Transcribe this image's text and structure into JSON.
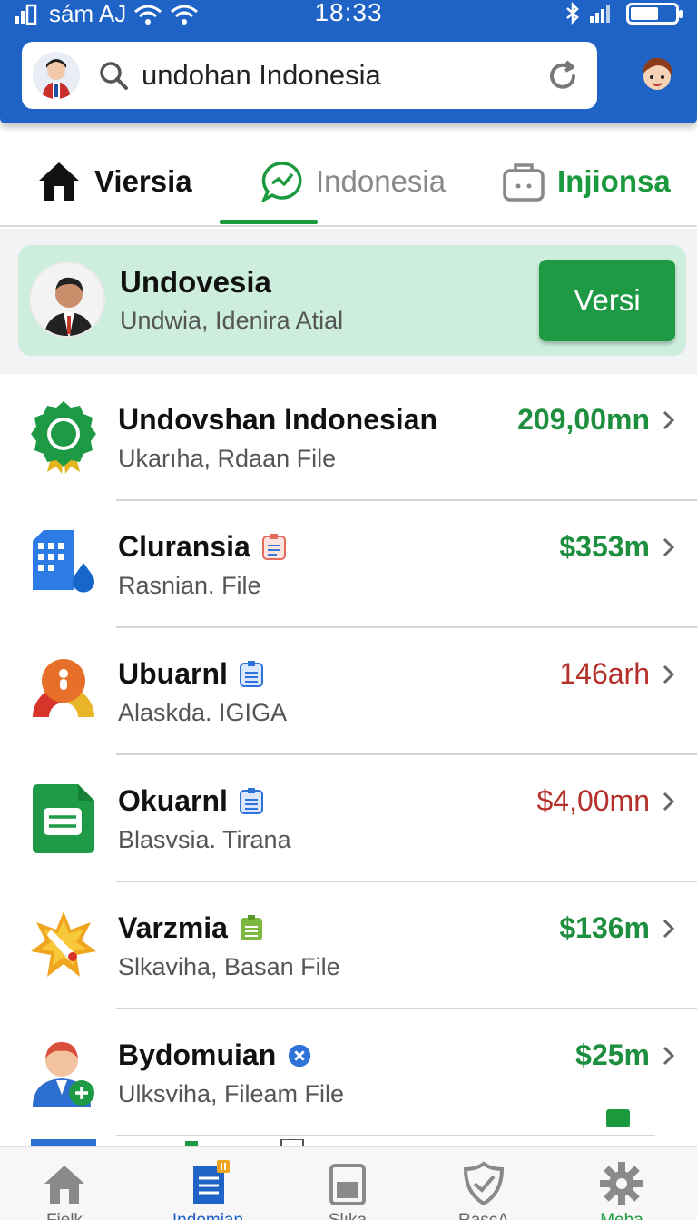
{
  "status_bar": {
    "carrier": "sám AJ",
    "time": "18:33"
  },
  "search": {
    "value": "undohan Indonesia"
  },
  "tabs": [
    {
      "label": "Viersia"
    },
    {
      "label": "Indonesia"
    },
    {
      "label": "Injionsa"
    }
  ],
  "promo": {
    "title": "Undovesia",
    "subtitle": "Undwia, Idenira Atial",
    "button": "Versi"
  },
  "items": [
    {
      "name": "Undovshan Indonesian",
      "meta": "Ukarıha, Rdaan File",
      "value": "209,00mn",
      "value_color": "#1e8f3e"
    },
    {
      "name": "Cluransia",
      "meta": "Rasnian. File",
      "value": "$353m",
      "value_color": "#1e8f3e"
    },
    {
      "name": "Ubuarnl",
      "meta": "Alaskda. IGIGA",
      "value": "146arh",
      "value_color": "#b5302a"
    },
    {
      "name": "Okuarnl",
      "meta": "Blasvsia. Tirana",
      "value": "$4,00mn",
      "value_color": "#b5302a"
    },
    {
      "name": "Varzmia",
      "meta": "Slkaviha, Basan File",
      "value": "$136m",
      "value_color": "#1e8f3e"
    },
    {
      "name": "Bydomuian",
      "meta": "Ulksviha, Fileam File",
      "value": "$25m",
      "value_color": "#1e8f3e"
    }
  ],
  "bottom_nav": [
    {
      "label": "Fielk",
      "icon": "home-icon"
    },
    {
      "label": "Indomian",
      "icon": "document-icon"
    },
    {
      "label": "Slıka",
      "icon": "tablet-icon"
    },
    {
      "label": "RascA",
      "icon": "shield-check-icon"
    },
    {
      "label": "Meha",
      "icon": "gear-icon"
    }
  ],
  "colors": {
    "header": "#1f63c6",
    "accent_green": "#1a9a3c",
    "promo_bg": "#cdeedd",
    "negative_red": "#b5302a"
  }
}
